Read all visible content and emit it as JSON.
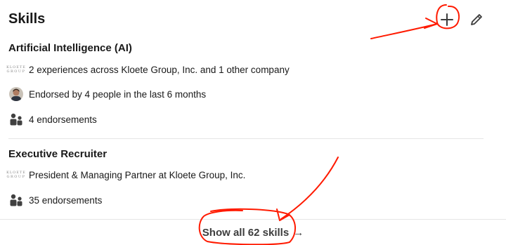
{
  "section": {
    "title": "Skills"
  },
  "skills": [
    {
      "name": "Artificial Intelligence (AI)",
      "experience": {
        "logo_text": "KLOETE",
        "logo_subtext": "GROUP",
        "text": "2 experiences across Kloete Group, Inc. and 1 other company"
      },
      "endorsed_by": "Endorsed by 4 people in the last 6 months",
      "endorsements": "4 endorsements"
    },
    {
      "name": "Executive Recruiter",
      "experience": {
        "logo_text": "KLOETE",
        "logo_subtext": "GROUP",
        "text": "President & Managing Partner at Kloete Group, Inc."
      },
      "endorsements": "35 endorsements"
    }
  ],
  "footer": {
    "show_all_label": "Show all 62 skills",
    "arrow": "→"
  },
  "colors": {
    "annotation_red": "#ff1a00",
    "text": "#191919",
    "divider": "#e6e6e6"
  }
}
